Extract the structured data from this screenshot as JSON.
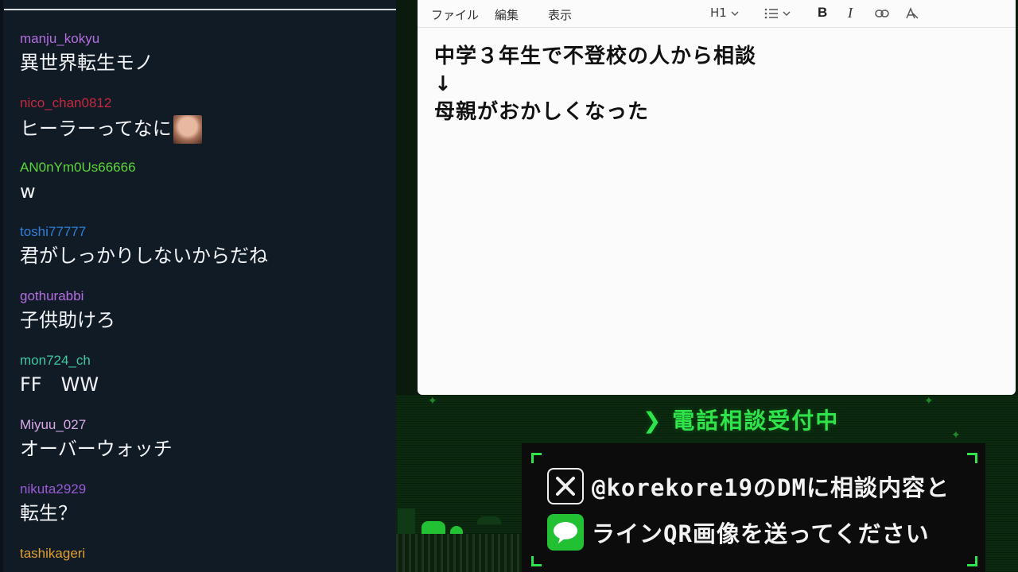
{
  "chat": {
    "messages": [
      {
        "user": "manju_kokyu",
        "text": "異世界転生モノ",
        "color": "#b46ee0"
      },
      {
        "user": "nico_chan0812",
        "text": "ヒーラーってなに",
        "color": "#c8293e",
        "emote": "face-emote"
      },
      {
        "user": "AN0nYm0Us66666",
        "text": "w",
        "color": "#5ad63a"
      },
      {
        "user": "toshi77777",
        "text": "君がしっかりしないからだね",
        "color": "#2f80d8"
      },
      {
        "user": "gothurabbi",
        "text": "子供助けろ",
        "color": "#b46ee0"
      },
      {
        "user": "mon724_ch",
        "text": "FF　WW",
        "color": "#3dc9a0"
      },
      {
        "user": "Miyuu_027",
        "text": "オーバーウォッチ",
        "color": "#d9a8e8"
      },
      {
        "user": "nikuta2929",
        "text": "転生？",
        "color": "#9a5ad8"
      },
      {
        "user": "tashikageri",
        "text": "",
        "color": "#e0a030"
      }
    ]
  },
  "editor": {
    "menu": [
      "ファイル",
      "編集",
      "表示"
    ],
    "heading_label": "H1",
    "doc_lines": [
      "中学３年生で不登校の人から相談",
      "↓",
      "母親がおかしくなった"
    ]
  },
  "overlay": {
    "status": "電話相談受付中",
    "status_icon": "chevron-right-icon",
    "line1": "@korekore19のDMに相談内容と",
    "line2": "ラインQR画像を送ってください",
    "accent": "#2fe34a"
  }
}
